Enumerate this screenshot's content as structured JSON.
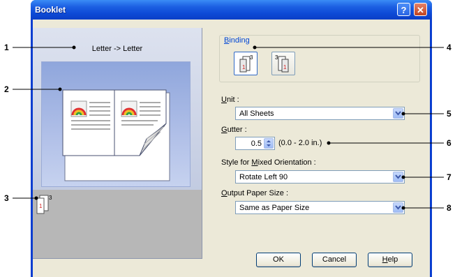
{
  "window": {
    "title": "Booklet",
    "help_symbol": "?",
    "close_symbol": "✕"
  },
  "preview": {
    "label": "Letter -> Letter",
    "bottom_icon": "booklet-left-binding-icon",
    "icon_page_numbers": [
      "1",
      "3"
    ]
  },
  "binding": {
    "label_html_parts": [
      "B",
      "inding"
    ],
    "left_icon": "left-binding-icon",
    "right_icon": "right-binding-icon",
    "left_numbers": [
      "1",
      "3"
    ],
    "right_numbers": [
      "3",
      "1"
    ]
  },
  "unit": {
    "label_pre": "U",
    "label_post": "nit :",
    "value": "All Sheets"
  },
  "gutter": {
    "label_pre": "G",
    "label_post": "utter :",
    "value": "0.5",
    "range": "(0.0 - 2.0 in.)"
  },
  "mixed": {
    "label_pre": "Style for ",
    "label_u": "M",
    "label_post": "ixed Orientation :",
    "value": "Rotate Left 90"
  },
  "output": {
    "label_pre": "O",
    "label_post": "utput Paper Size :",
    "value": "Same as Paper Size"
  },
  "buttons": {
    "ok": "OK",
    "cancel": "Cancel",
    "help_pre": "H",
    "help_post": "elp"
  },
  "callouts": [
    "1",
    "2",
    "3",
    "4",
    "5",
    "6",
    "7",
    "8"
  ],
  "colors": {
    "title_bar": "#0d49d6",
    "dialog_bg": "#ece9d8",
    "preview_bg": "#b6bfd6",
    "accent_red": "#d42020"
  }
}
